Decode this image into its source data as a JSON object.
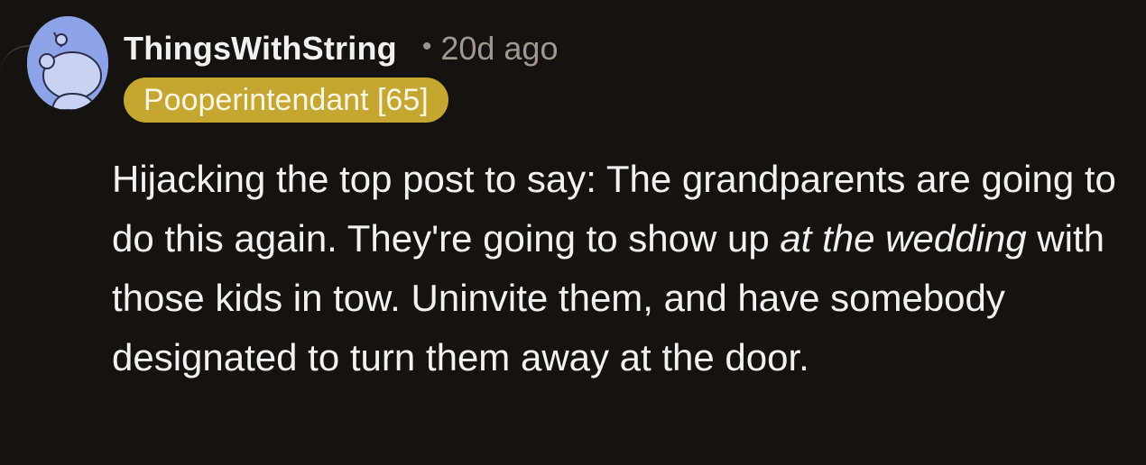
{
  "comment": {
    "username": "ThingsWithString",
    "separator": "•",
    "timestamp": "20d ago",
    "flair": "Pooperintendant [65]",
    "body": {
      "part1": "Hijacking the top post to say: The grandparents are going to do this again. They're going to show up ",
      "emphasis": "at the wedding",
      "part2": " with those kids in tow. Uninvite them, and have somebody designated to turn them away at the door."
    }
  },
  "colors": {
    "background": "#15120f",
    "flair_bg": "#c4a631",
    "avatar_bg": "#8ea2e8",
    "timestamp": "#9f9891"
  },
  "icons": {
    "avatar": "snoo-avatar-icon"
  }
}
